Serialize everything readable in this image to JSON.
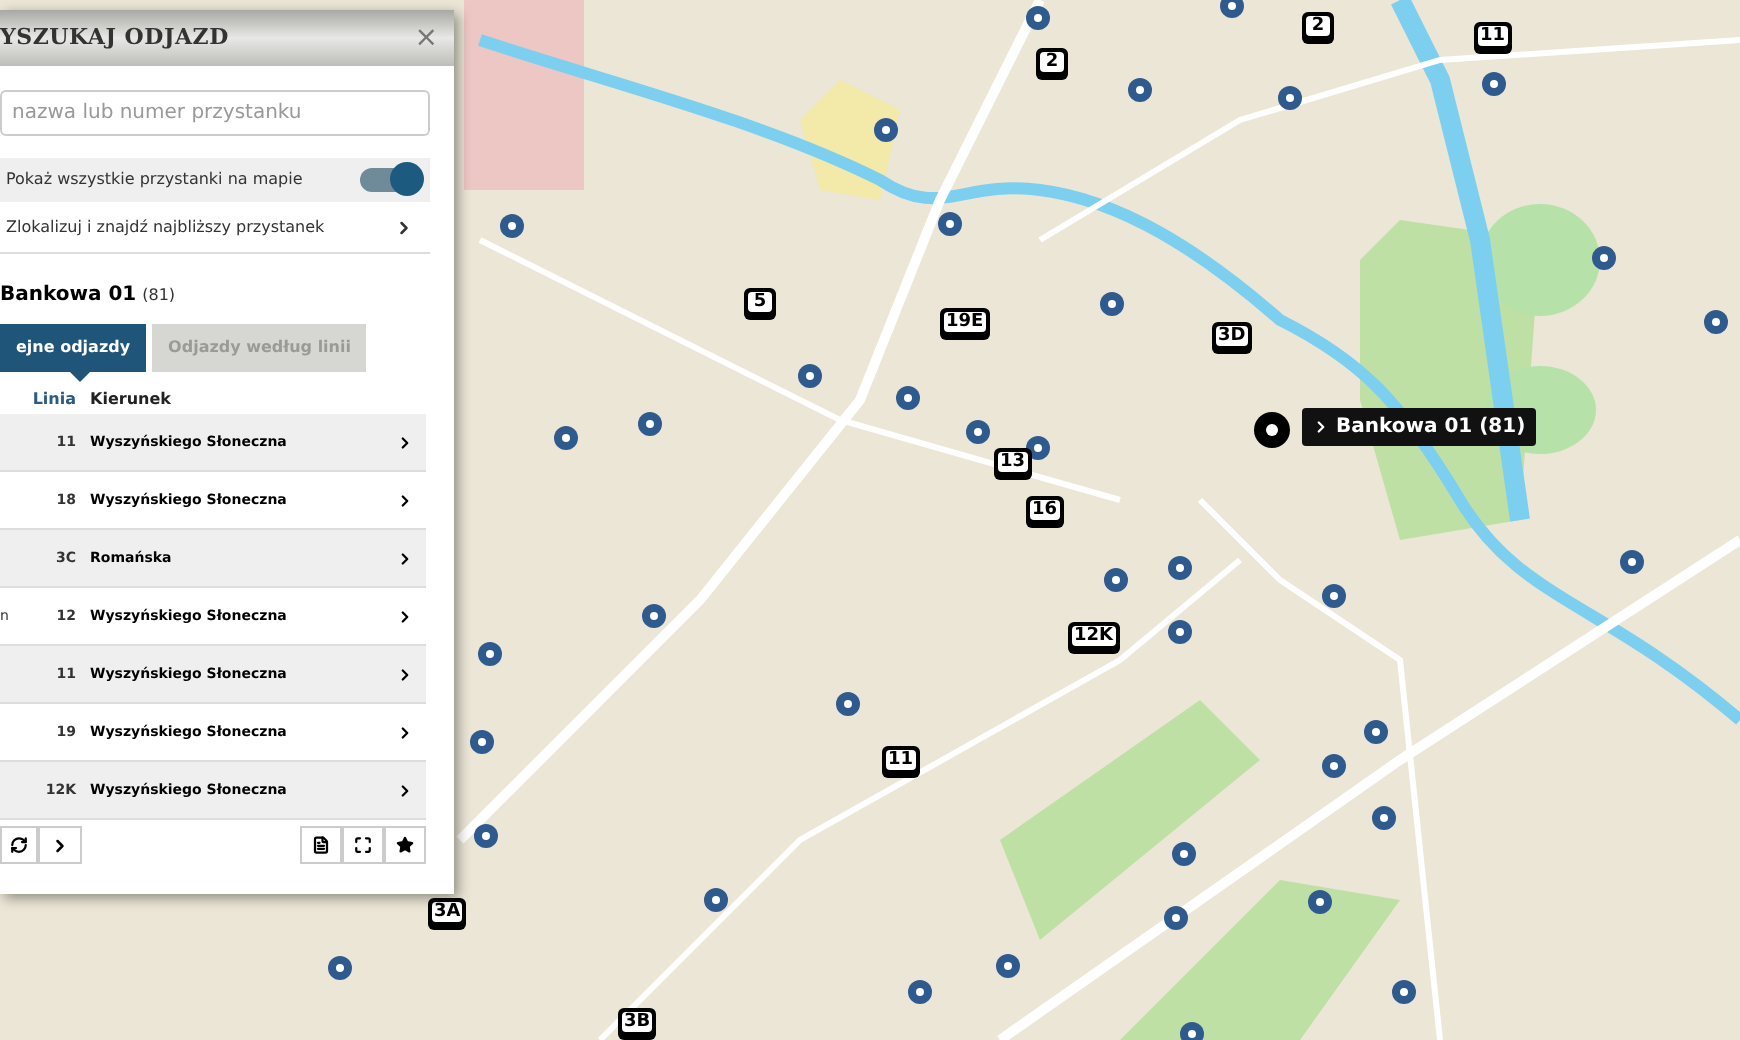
{
  "panel": {
    "title": "YSZUKAJ ODJAZD",
    "close": "×",
    "search": {
      "placeholder": "nazwa lub numer przystanku"
    },
    "toggle": {
      "label": "Pokaż wszystkie przystanki na mapie",
      "on": true
    },
    "locate": {
      "label": "Zlokalizuj i znajdź najbliższy przystanek"
    },
    "stop": {
      "name": "Bankowa 01",
      "number": "(81)"
    },
    "tabs": [
      {
        "label": "ejne odjazdy",
        "selected": true
      },
      {
        "label": "Odjazdy według linii",
        "selected": false
      }
    ],
    "table": {
      "columns": [
        "Linia",
        "Kierunek"
      ],
      "rows": [
        {
          "line": "11",
          "direction": "Wyszyńskiego Słoneczna"
        },
        {
          "line": "18",
          "direction": "Wyszyńskiego Słoneczna"
        },
        {
          "line": "3C",
          "direction": "Romańska"
        },
        {
          "column_1": "n",
          "line": "12",
          "direction": "Wyszyńskiego Słoneczna"
        },
        {
          "line": "11",
          "direction": "Wyszyńskiego Słoneczna"
        },
        {
          "line": "19",
          "direction": "Wyszyńskiego Słoneczna"
        },
        {
          "line": "12K",
          "direction": "Wyszyńskiego Słoneczna"
        }
      ]
    }
  },
  "map": {
    "tooltip": "Bankowa 01 (81)",
    "buses": [
      {
        "line": "2"
      },
      {
        "line": "2"
      },
      {
        "line": "11"
      },
      {
        "line": "5"
      },
      {
        "line": "19E"
      },
      {
        "line": "3D"
      },
      {
        "line": "13"
      },
      {
        "line": "16"
      },
      {
        "line": "12K"
      },
      {
        "line": "11"
      },
      {
        "line": "3A"
      },
      {
        "line": "3B"
      }
    ]
  }
}
